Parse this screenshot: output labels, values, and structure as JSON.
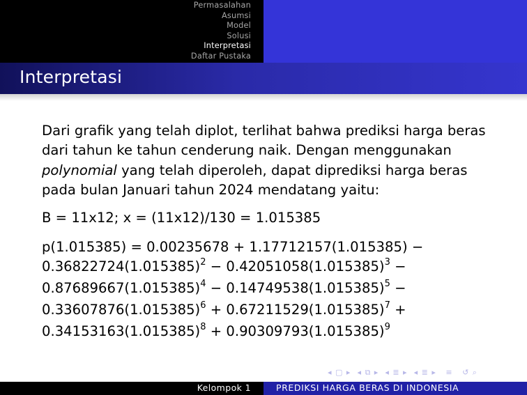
{
  "nav": {
    "items": [
      "Permasalahan",
      "Asumsi",
      "Model",
      "Solusi",
      "Interpretasi",
      "Daftar Pustaka"
    ],
    "active": "Interpretasi"
  },
  "frame": {
    "title": "Interpretasi"
  },
  "body": {
    "p1_a": "Dari grafik yang telah diplot, terlihat bahwa prediksi harga beras dari tahun ke tahun cenderung naik. Dengan menggunakan ",
    "p1_em": "polynomial",
    "p1_b": " yang telah diperoleh, dapat diprediksi harga beras pada bulan Januari tahun 2024 mendatang yaitu:",
    "eq1": "B = 11x12; x = (11x12)/130 = 1.015385",
    "eq2": {
      "l1": "p(1.015385) = 0.00235678 + 1.17712157(1.015385) −",
      "l2a": "0.36822724(1.015385)",
      "l2e1": "2",
      "l2b": " − 0.42051058(1.015385)",
      "l2e2": "3",
      "l2c": " −",
      "l3a": "0.87689667(1.015385)",
      "l3e1": "4",
      "l3b": " − 0.14749538(1.015385)",
      "l3e2": "5",
      "l3c": " −",
      "l4a": "0.33607876(1.015385)",
      "l4e1": "6",
      "l4b": " + 0.67211529(1.015385)",
      "l4e2": "7",
      "l4c": " +",
      "l5a": "0.34153163(1.015385)",
      "l5e1": "8",
      "l5b": " + 0.90309793(1.015385)",
      "l5e2": "9"
    }
  },
  "footer": {
    "left": "Kelompok 1",
    "right": "PREDIKSI HARGA BERAS DI INDONESIA"
  },
  "colors": {
    "header_left": "#000000",
    "header_right": "#3434d8",
    "title_gradient_start": "#11115a",
    "title_gradient_end": "#3535cf",
    "footer_right": "#2121a6"
  }
}
